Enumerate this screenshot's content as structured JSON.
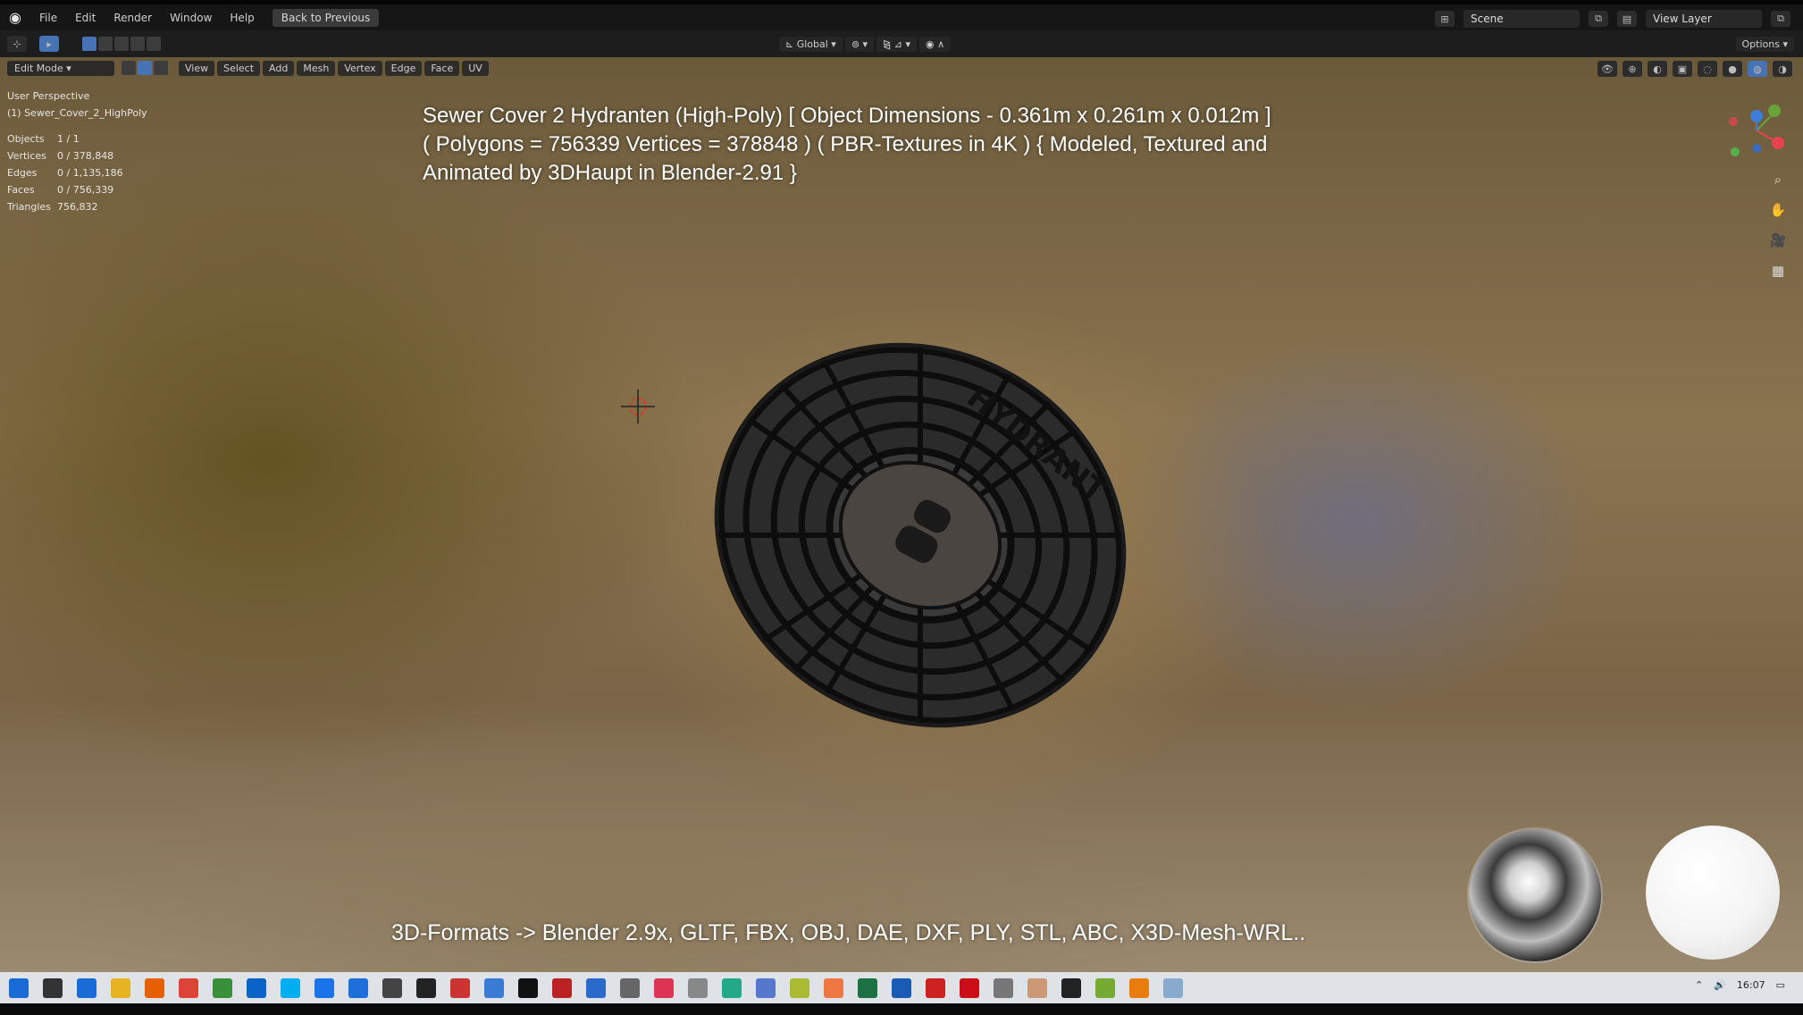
{
  "topbar": {
    "menus": [
      "File",
      "Edit",
      "Render",
      "Window",
      "Help"
    ],
    "back_button": "Back to Previous",
    "scene_label": "Scene",
    "view_layer_label": "View Layer"
  },
  "header": {
    "transform_orientation": "Global",
    "options_label": "Options"
  },
  "viewport_header": {
    "mode": "Edit Mode",
    "menus": [
      "View",
      "Select",
      "Add",
      "Mesh",
      "Vertex",
      "Edge",
      "Face",
      "UV"
    ]
  },
  "stats": {
    "view_name": "User Perspective",
    "object_name": "(1) Sewer_Cover_2_HighPoly",
    "rows": [
      {
        "label": "Objects",
        "value": "1 / 1"
      },
      {
        "label": "Vertices",
        "value": "0 / 378,848"
      },
      {
        "label": "Edges",
        "value": "0 / 1,135,186"
      },
      {
        "label": "Faces",
        "value": "0 / 756,339"
      },
      {
        "label": "Triangles",
        "value": "756,832"
      }
    ]
  },
  "overlay": {
    "line1": "Sewer Cover 2 Hydranten (High-Poly) [ Object Dimensions -  0.361m x 0.261m x 0.012m ]",
    "line2": "( Polygons = 756339 Vertices = 378848 ) ( PBR-Textures in 4K ) { Modeled, Textured and",
    "line3": "Animated by 3DHaupt in Blender-2.91 }",
    "formats": "3D-Formats -> Blender 2.9x, GLTF, FBX, OBJ, DAE, DXF, PLY, STL, ABC, X3D-Mesh-WRL.."
  },
  "cover": {
    "text": "HYDRANT"
  },
  "gizmo": {
    "x_label": "X",
    "y_label": "Y",
    "z_label": "Z",
    "colors": {
      "x": "#e5434d",
      "y": "#6ba33b",
      "z": "#3d7fd8"
    }
  },
  "taskbar": {
    "clock": "16:07",
    "icons": [
      "windows-icon",
      "search-icon",
      "store-icon",
      "explorer-icon",
      "firefox-icon",
      "chrome-icon",
      "notes-icon",
      "outlook-icon",
      "skype-icon",
      "edge-icon",
      "app-icon",
      "app-icon",
      "app-icon",
      "app-icon",
      "app-icon",
      "app-icon",
      "app-icon",
      "app-icon",
      "app-icon",
      "app-icon",
      "app-icon",
      "app-icon",
      "app-icon",
      "app-icon",
      "app-icon",
      "excel-icon",
      "word-icon",
      "app-icon",
      "opera-icon",
      "app-icon",
      "app-icon",
      "app-icon",
      "app-icon",
      "blender-icon",
      "app-icon"
    ],
    "icon_colors": [
      "#1b6bd6",
      "#333",
      "#1b6bd6",
      "#e6b422",
      "#e66000",
      "#db4437",
      "#3a8f3a",
      "#0a64c8",
      "#00aff0",
      "#1a73e8",
      "#1e6fd9",
      "#444",
      "#222",
      "#c33",
      "#3a7bd5",
      "#111",
      "#b22",
      "#2a6acb",
      "#666",
      "#d35",
      "#888",
      "#2a8",
      "#5577cc",
      "#ab3",
      "#e74",
      "#1d7044",
      "#1a5bb5",
      "#c22",
      "#cc0f16",
      "#777",
      "#c97",
      "#222",
      "#7a3",
      "#e87d0d",
      "#8ac"
    ]
  }
}
